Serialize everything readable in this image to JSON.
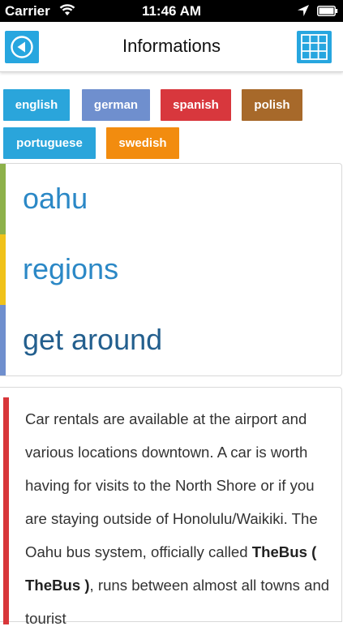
{
  "status_bar": {
    "carrier": "Carrier",
    "time": "11:46 AM"
  },
  "nav": {
    "title": "Informations"
  },
  "languages": [
    {
      "label": "english",
      "color": "#2aa5db"
    },
    {
      "label": "german",
      "color": "#6f8fce"
    },
    {
      "label": "spanish",
      "color": "#d8373d"
    },
    {
      "label": "polish",
      "color": "#a7692a"
    },
    {
      "label": "portuguese",
      "color": "#2aa5db"
    },
    {
      "label": "swedish",
      "color": "#f28c0f"
    }
  ],
  "menu": [
    {
      "label": "oahu",
      "accent": "#8db14a",
      "text_color": "#2b88c6"
    },
    {
      "label": "regions",
      "accent": "#f0c21a",
      "text_color": "#2b88c6"
    },
    {
      "label": "get around",
      "accent": "#6f8fce",
      "text_color": "#235f8e"
    }
  ],
  "description": {
    "accent": "#d8363a",
    "text_before": "Car rentals are available at the airport and various locations downtown. A car is worth having for visits to the North Shore or if you are staying outside of Honolulu/Waikiki. The Oahu bus system, officially called ",
    "bold_text": "TheBus ( TheBus )",
    "text_after": ", runs between almost all towns and tourist"
  }
}
